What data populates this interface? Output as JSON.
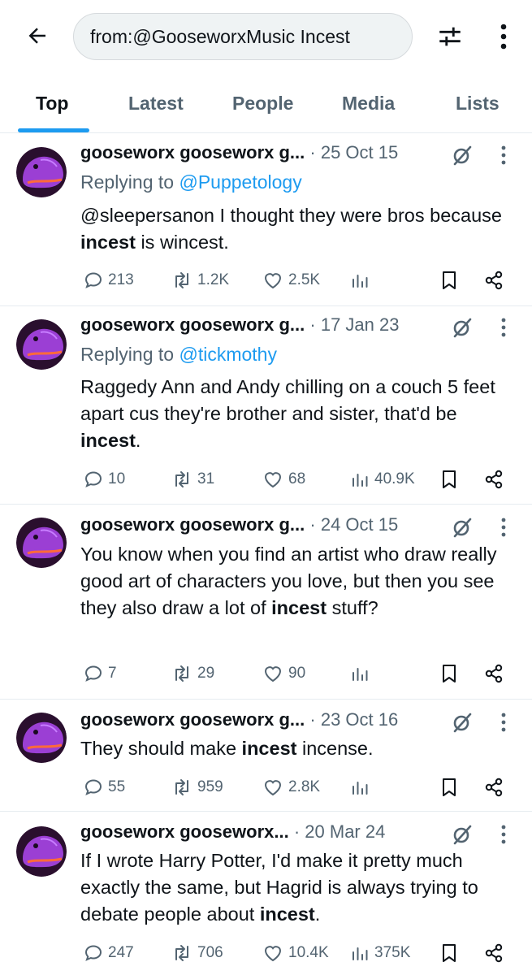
{
  "search": {
    "query": "from:@GooseworxMusic Incest"
  },
  "icons": {
    "back": "arrow-left-icon",
    "filter": "sliders-icon",
    "more": "more-vertical-icon"
  },
  "tabs": [
    {
      "label": "Top",
      "active": true
    },
    {
      "label": "Latest"
    },
    {
      "label": "People"
    },
    {
      "label": "Media"
    },
    {
      "label": "Lists"
    }
  ],
  "colors": {
    "accent": "#1d9bf0",
    "muted": "#536471",
    "text": "#0f1419"
  },
  "tweets": [
    {
      "name": "gooseworx gooseworx g...",
      "date": "· 25 Oct 15",
      "replying_label": "Replying to",
      "replying_to": "@Puppetology",
      "text_before": "@sleepersanon I thought they were bros because ",
      "highlight": "incest",
      "text_after": " is wincest.",
      "replies": "213",
      "reposts": "1.2K",
      "likes": "2.5K",
      "views": ""
    },
    {
      "name": "gooseworx gooseworx g...",
      "date": "· 17 Jan 23",
      "replying_label": "Replying to",
      "replying_to": "@tickmothy",
      "text_before": "Raggedy Ann and Andy chilling on a couch 5 feet apart cus they're brother and sister, that'd be ",
      "highlight": "incest",
      "text_after": ".",
      "replies": "10",
      "reposts": "31",
      "likes": "68",
      "views": "40.9K"
    },
    {
      "name": "gooseworx gooseworx g...",
      "date": "· 24 Oct 15",
      "text_before": "You know when you find an artist who draw really good art of characters you love, but then you see they also draw a lot of ",
      "highlight": "incest",
      "text_after": " stuff?",
      "replies": "7",
      "reposts": "29",
      "likes": "90",
      "views": ""
    },
    {
      "name": "gooseworx gooseworx g...",
      "date": "· 23 Oct 16",
      "text_before": "They should make ",
      "highlight": "incest",
      "text_after": " incense.",
      "replies": "55",
      "reposts": "959",
      "likes": "2.8K",
      "views": ""
    },
    {
      "name": "gooseworx gooseworx...",
      "date": "· 20 Mar 24",
      "text_before": "If I wrote Harry Potter, I'd make it pretty much exactly the same, but Hagrid is always trying to debate people about ",
      "highlight": "incest",
      "text_after": ".",
      "replies": "247",
      "reposts": "706",
      "likes": "10.4K",
      "views": "375K"
    }
  ]
}
